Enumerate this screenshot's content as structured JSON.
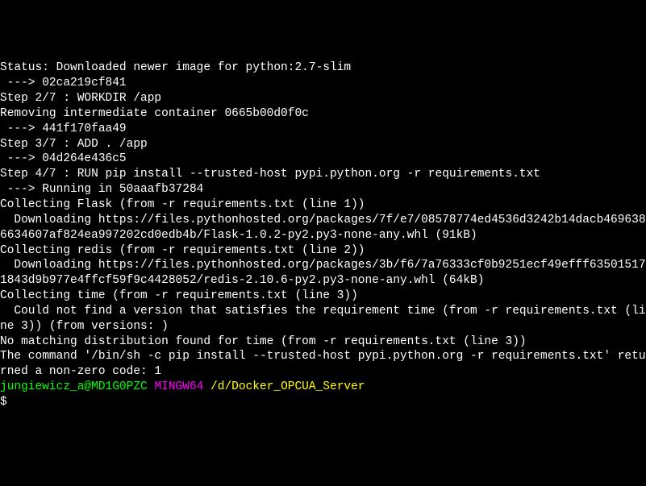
{
  "output": {
    "line1": "Status: Downloaded newer image for python:2.7-slim",
    "line2": " ---> 02ca219cf841",
    "line3": "Step 2/7 : WORKDIR /app",
    "line4": "Removing intermediate container 0665b00d0f0c",
    "line5": " ---> 441f170faa49",
    "line6": "Step 3/7 : ADD . /app",
    "line7": " ---> 04d264e436c5",
    "line8": "Step 4/7 : RUN pip install --trusted-host pypi.python.org -r requirements.txt",
    "line9": " ---> Running in 50aaafb37284",
    "line10": "Collecting Flask (from -r requirements.txt (line 1))",
    "line11": "  Downloading https://files.pythonhosted.org/packages/7f/e7/08578774ed4536d3242b14dacb4696386634607af824ea997202cd0edb4b/Flask-1.0.2-py2.py3-none-any.whl (91kB)",
    "line12": "Collecting redis (from -r requirements.txt (line 2))",
    "line13": "  Downloading https://files.pythonhosted.org/packages/3b/f6/7a76333cf0b9251ecf49efff635015171843d9b977e4ffcf59f9c4428052/redis-2.10.6-py2.py3-none-any.whl (64kB)",
    "line14": "Collecting time (from -r requirements.txt (line 3))",
    "line15": "  Could not find a version that satisfies the requirement time (from -r requirements.txt (line 3)) (from versions: )",
    "line16": "No matching distribution found for time (from -r requirements.txt (line 3))",
    "line17": "The command '/bin/sh -c pip install --trusted-host pypi.python.org -r requirements.txt' returned a non-zero code: 1",
    "blank": ""
  },
  "prompt": {
    "user": "jungiewicz_a@MD1G0PZC",
    "space1": " ",
    "mingw": "MINGW64",
    "space2": " ",
    "path": "/d/Docker_OPCUA_Server",
    "dollar": "$"
  }
}
